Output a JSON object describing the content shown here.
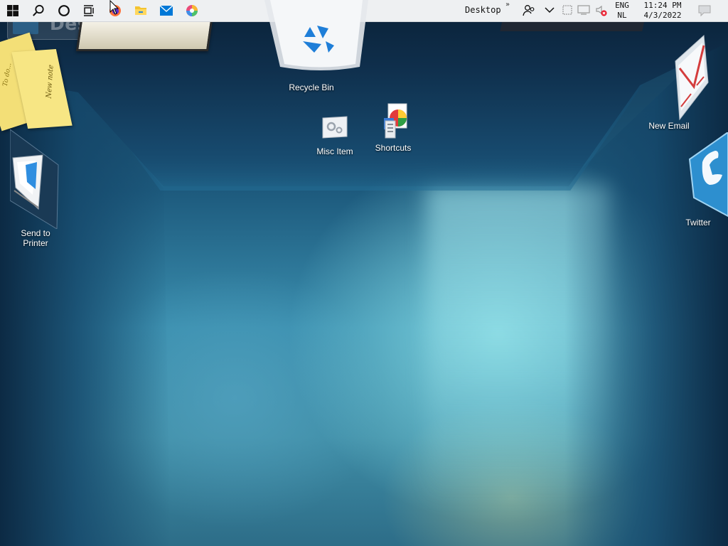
{
  "taskbar": {
    "buttons": [
      {
        "name": "start-button",
        "icon": "windows-logo-icon"
      },
      {
        "name": "search-button",
        "icon": "search-icon"
      },
      {
        "name": "cortana-button",
        "icon": "circle-icon"
      },
      {
        "name": "task-view-button",
        "icon": "task-view-icon"
      },
      {
        "name": "firefox-button",
        "icon": "firefox-icon"
      },
      {
        "name": "file-explorer-button",
        "icon": "folder-icon"
      },
      {
        "name": "mail-button",
        "icon": "mail-icon"
      },
      {
        "name": "color-app-button",
        "icon": "color-wheel-icon"
      }
    ],
    "toolbar_label": "Desktop",
    "toolbar_chevron": "»",
    "tray": {
      "language_line1": "ENG",
      "language_line2": "NL",
      "time": "11:24 PM",
      "date": "4/3/2022"
    }
  },
  "desktop": {
    "watermark": "Desktop",
    "icons": [
      {
        "name": "recycle-bin",
        "label": "Recycle Bin"
      },
      {
        "name": "misc-item",
        "label": "Misc Item"
      },
      {
        "name": "shortcuts",
        "label": "Shortcuts"
      },
      {
        "name": "new-email",
        "label": "New Email"
      },
      {
        "name": "send-to-printer",
        "label": "Send to\nPrinter"
      },
      {
        "name": "twitter",
        "label": "Twitter"
      }
    ],
    "sticky_notes": [
      "New note",
      "To do..."
    ]
  },
  "colors": {
    "taskbar_bg": "#eef0f2",
    "accent_blue": "#0078d7",
    "firefox_orange": "#ff7139",
    "folder_yellow": "#f4c430",
    "note_yellow": "#f6e27a"
  }
}
